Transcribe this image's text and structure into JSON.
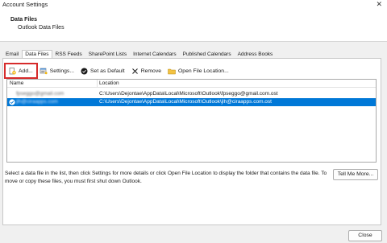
{
  "window": {
    "title": "Account Settings"
  },
  "header": {
    "title": "Data Files",
    "subtitle": "Outlook Data Files"
  },
  "tabs": [
    {
      "label": "Email"
    },
    {
      "label": "Data Files",
      "active": true
    },
    {
      "label": "RSS Feeds"
    },
    {
      "label": "SharePoint Lists"
    },
    {
      "label": "Internet Calendars"
    },
    {
      "label": "Published Calendars"
    },
    {
      "label": "Address Books"
    }
  ],
  "toolbar": {
    "add": "Add...",
    "settings": "Settings...",
    "set_default": "Set as Default",
    "remove": "Remove",
    "open_location": "Open File Location..."
  },
  "list": {
    "columns": {
      "name": "Name",
      "location": "Location"
    },
    "rows": [
      {
        "name": "fpseggo@gmail.com",
        "location": "C:\\Users\\Dejontae\\AppData\\Local\\Microsoft\\Outlook\\fpseggo@gmail.com.ost",
        "selected": false,
        "default": false
      },
      {
        "name": "jlh@ciraapps.com",
        "location": "C:\\Users\\Dejontae\\AppData\\Local\\Microsoft\\Outlook\\jlh@ciraapps.com.ost",
        "selected": true,
        "default": true
      }
    ]
  },
  "help_text": "Select a data file in the list, then click Settings for more details or click Open File Location to display the folder that contains the data file. To move or copy these files, you must first shut down Outlook.",
  "buttons": {
    "tell_me_more": "Tell Me More...",
    "close": "Close"
  },
  "colors": {
    "selection": "#0078d7",
    "highlight_outline": "#d62b2b"
  }
}
